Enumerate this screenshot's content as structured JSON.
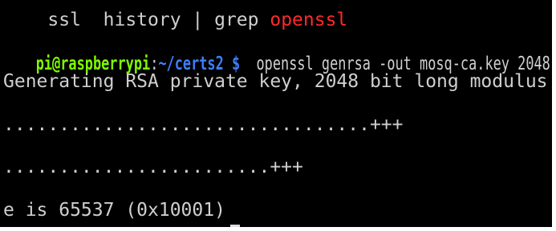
{
  "terminal": {
    "previous_cmd": {
      "prefix": "ssl  history | grep ",
      "highlight": "openssl"
    },
    "prompt": {
      "user_host": "pi@raspberrypi",
      "colon": ":",
      "path": "~/certs2 $",
      "command": "  openssl genrsa -out mosq-ca.key 2048"
    },
    "output": {
      "line1": "Generating RSA private key, 2048 bit long modulus",
      "line2": ".................................+++",
      "line3": "........................+++",
      "line4": "e is 65537 (0x10001)"
    }
  },
  "colors": {
    "background": "#000000",
    "text": "#cfcfcf",
    "prompt_user": "#7cfc00",
    "prompt_path": "#3f7dff",
    "highlight": "#ff2a2a"
  }
}
